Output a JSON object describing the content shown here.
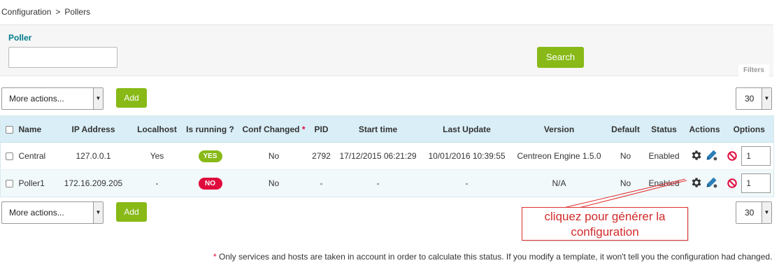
{
  "breadcrumb": {
    "parent": "Configuration",
    "separator": ">",
    "current": "Pollers"
  },
  "filter": {
    "label": "Poller",
    "value": "",
    "search_label": "Search",
    "filters_tab": "Filters"
  },
  "toolbar": {
    "more_actions": "More actions...",
    "add_label": "Add",
    "limit": "30"
  },
  "table": {
    "headers": {
      "name": "Name",
      "ip": "IP Address",
      "localhost": "Localhost",
      "running": "Is running ?",
      "conf_changed": "Conf Changed",
      "conf_star": "*",
      "pid": "PID",
      "start_time": "Start time",
      "last_update": "Last Update",
      "version": "Version",
      "default": "Default",
      "status": "Status",
      "actions": "Actions",
      "options": "Options"
    },
    "rows": [
      {
        "name": "Central",
        "ip": "127.0.0.1",
        "localhost": "Yes",
        "running": "YES",
        "conf_changed": "No",
        "pid": "2792",
        "start_time": "17/12/2015 06:21:29",
        "last_update": "10/01/2016 10:39:55",
        "version": "Centreon Engine 1.5.0",
        "default": "No",
        "status": "Enabled",
        "option_value": "1"
      },
      {
        "name": "Poller1",
        "ip": "172.16.209.205",
        "localhost": "-",
        "running": "NO",
        "conf_changed": "No",
        "pid": "-",
        "start_time": "-",
        "last_update": "-",
        "version": "N/A",
        "default": "No",
        "status": "Enabled",
        "option_value": "1"
      }
    ]
  },
  "callout": {
    "line1": "cliquez pour générer la",
    "line2": "configuration"
  },
  "footnote": {
    "star": "*",
    "text": " Only services and hosts are taken in account in order to calculate this status. If you modify a template, it won't tell you the configuration had changed."
  },
  "colors": {
    "accent_green": "#88b917",
    "danger_red": "#e00b3d",
    "header_blue": "#d9eef6",
    "label_teal": "#007a8b"
  },
  "icons": [
    "gear-icon",
    "edit-pencil-icon",
    "no-entry-icon",
    "dropdown-arrow-icon"
  ]
}
